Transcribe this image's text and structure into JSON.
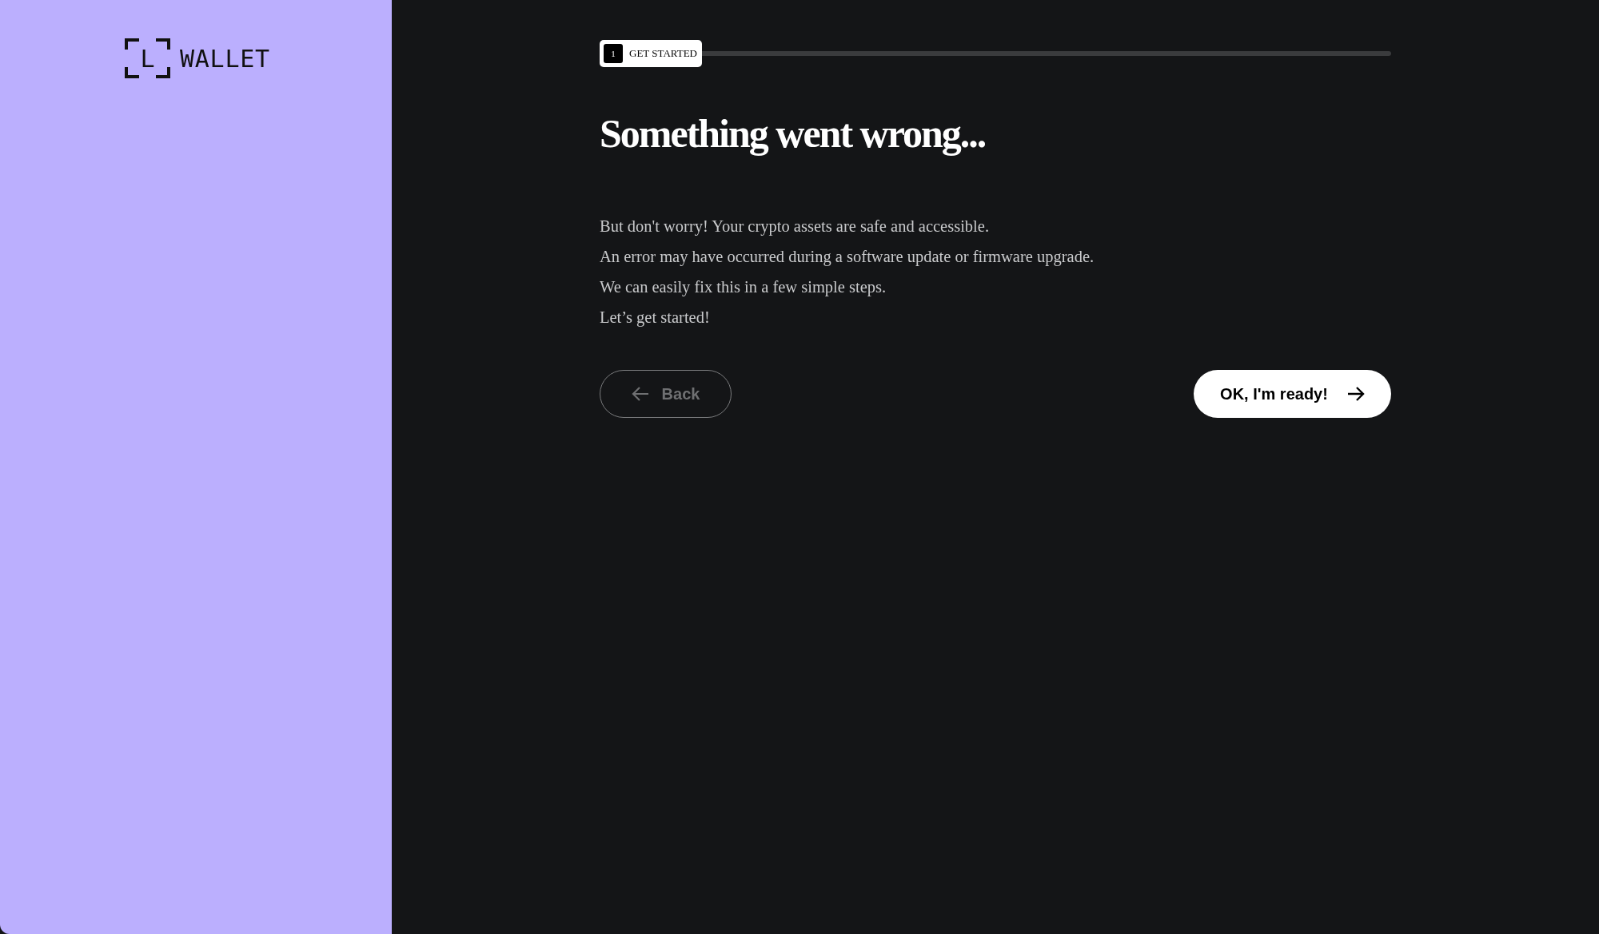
{
  "sidebar": {
    "logo_letter": "L",
    "logo_text": "WALLET"
  },
  "progress": {
    "step_number": "1",
    "step_label": "GET STARTED"
  },
  "heading": "Something went wrong...",
  "paragraphs": [
    "But don't worry! Your crypto assets are safe and accessible.",
    "An error may have occurred during a software update or firmware upgrade.",
    "We can easily fix this in a few simple steps.",
    "Let’s get started!"
  ],
  "back_button": {
    "label": "Back",
    "disabled": true
  },
  "next_button": {
    "label": "OK, I'm ready!"
  }
}
